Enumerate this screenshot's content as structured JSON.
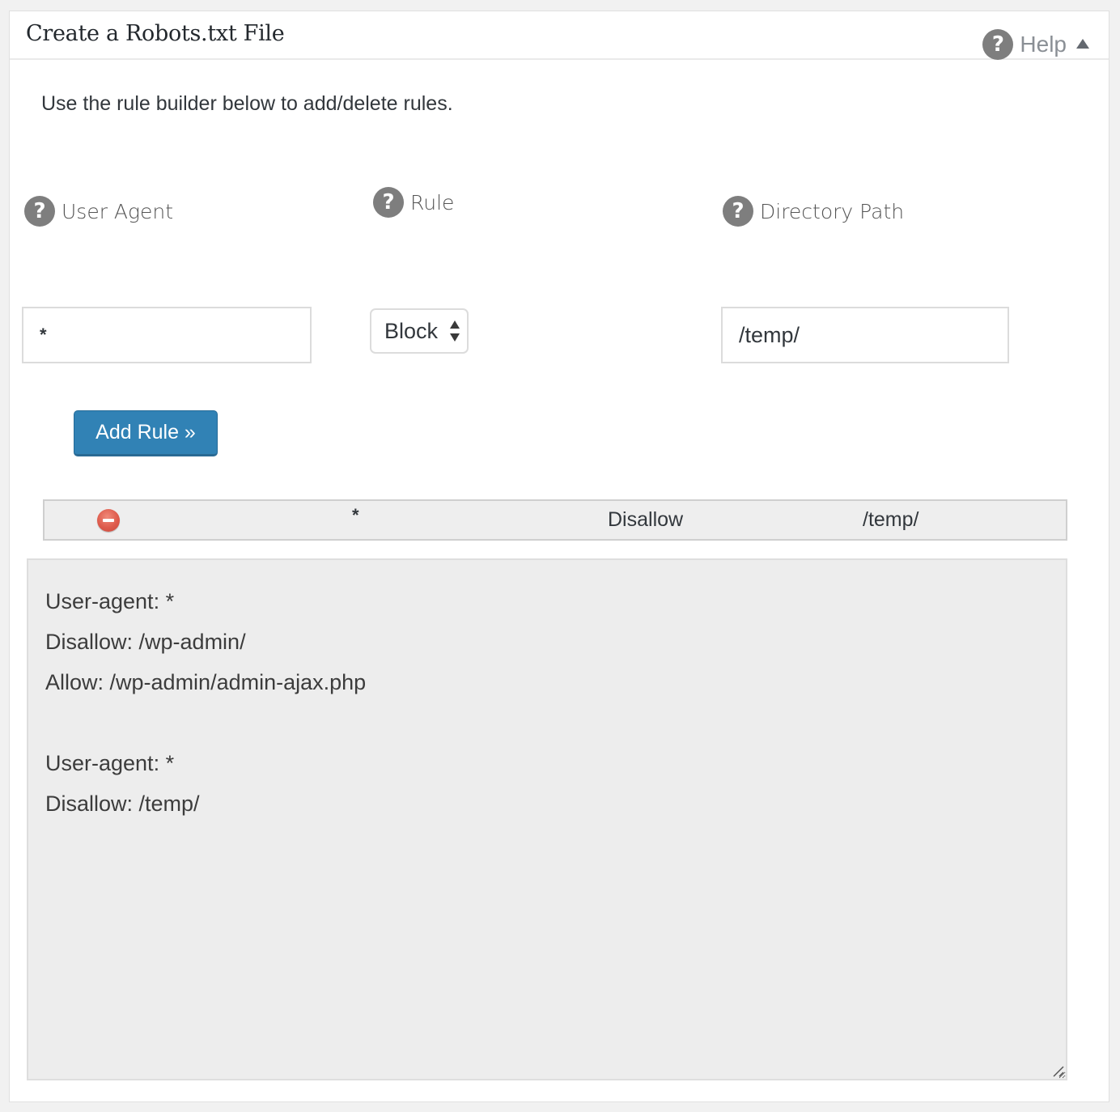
{
  "panel": {
    "title": "Create a Robots.txt File",
    "help_label": "Help",
    "help_icon": "question-circle-icon",
    "help_toggle_icon": "caret-up-icon"
  },
  "intro_text": "Use the rule builder below to add/delete rules.",
  "form": {
    "user_agent": {
      "label": "User Agent",
      "value": "*",
      "help_icon": "question-circle-icon"
    },
    "rule": {
      "label": "Rule",
      "selected": "Block",
      "help_icon": "question-circle-icon"
    },
    "directory_path": {
      "label": "Directory Path",
      "value": "/temp/",
      "help_icon": "question-circle-icon"
    },
    "add_button_label": "Add Rule »"
  },
  "rules": [
    {
      "delete_icon": "minus-circle-icon",
      "user_agent": "*",
      "rule": "Disallow",
      "path": "/temp/"
    }
  ],
  "robots_txt": "User-agent: *\nDisallow: /wp-admin/\nAllow: /wp-admin/admin-ajax.php\n\nUser-agent: *\nDisallow: /temp/",
  "colors": {
    "primary_button": "#3182b5",
    "delete_icon": "#de5b4c",
    "help_icon": "#7e7e7e",
    "output_background": "#ededed"
  }
}
